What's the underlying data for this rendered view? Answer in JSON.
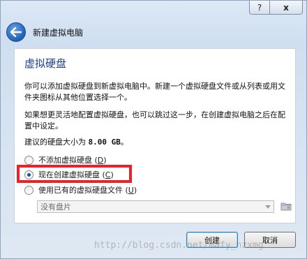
{
  "titlebar": {
    "help_label": "?",
    "close_label": "x"
  },
  "header": {
    "title": "新建虚拟电脑",
    "back_icon": "back-arrow-icon"
  },
  "page": {
    "title": "虚拟硬盘",
    "paragraph1": "你可以添加虚拟硬盘到新虚拟电脑中。新建一个虚拟硬盘文件或从列表或用文件夹图标从其他位置选择一个。",
    "paragraph2": "如果想更灵活地配置虚拟硬盘，也可以跳过这一步，在创建虚拟电脑之后在配置中设定。",
    "size_prefix": "建议的硬盘大小为 ",
    "size_value": "8.00 GB",
    "size_suffix": "。"
  },
  "options": [
    {
      "label": "不添加虚拟硬盘",
      "hotkey": "D",
      "checked": false
    },
    {
      "label": "现在创建虚拟硬盘",
      "hotkey": "C",
      "checked": true
    },
    {
      "label": "使用已有的虚拟硬盘文件",
      "hotkey": "U",
      "checked": false
    }
  ],
  "combo": {
    "value": "没有盘片"
  },
  "buttons": {
    "create": "创建",
    "cancel": "取消"
  },
  "watermark": "http://blog.csdn.net/mafy_nzxmg",
  "colors": {
    "highlight": "#e8232a",
    "title_blue": "#1c3f8c"
  }
}
